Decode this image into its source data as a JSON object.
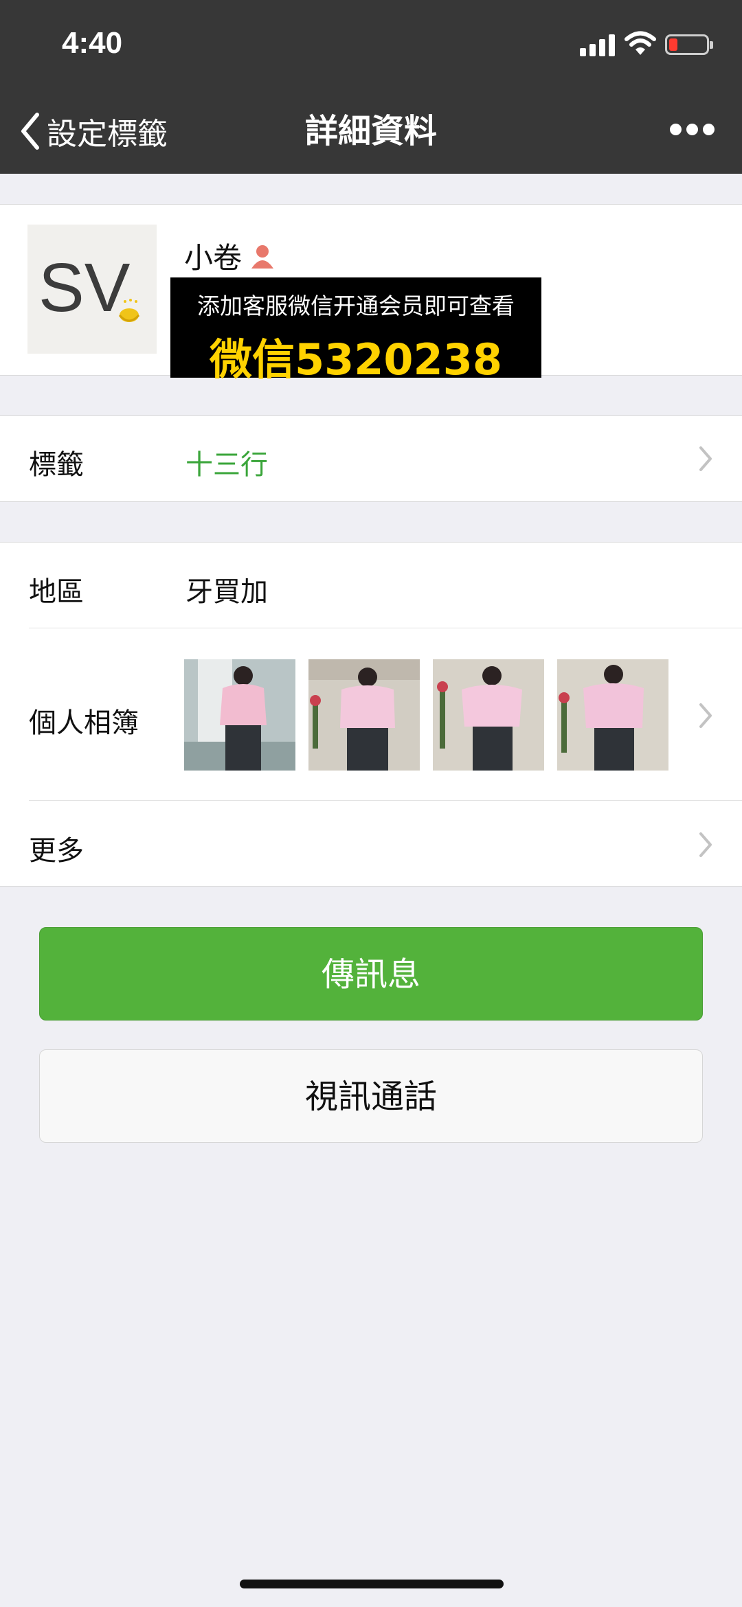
{
  "status_bar": {
    "time": "4:40",
    "battery_color": "#ff3b30"
  },
  "nav": {
    "back_label": "設定標籤",
    "title": "詳細資料",
    "more_icon": "more-dots-icon"
  },
  "profile": {
    "name": "小卷",
    "gender_icon": "female-icon",
    "avatar_text": "SV",
    "promo_line1": "添加客服微信开通会员即可查看",
    "promo_line2": "微信5320238"
  },
  "tags_row": {
    "label": "標籤",
    "value": "十三行",
    "value_color": "#3aa53a"
  },
  "region_row": {
    "label": "地區",
    "value": "牙買加"
  },
  "album_row": {
    "label": "個人相簿",
    "photo_count": 4
  },
  "more_row": {
    "label": "更多"
  },
  "buttons": {
    "message": "傳訊息",
    "video_call": "視訊通話",
    "message_color": "#53b23b"
  }
}
